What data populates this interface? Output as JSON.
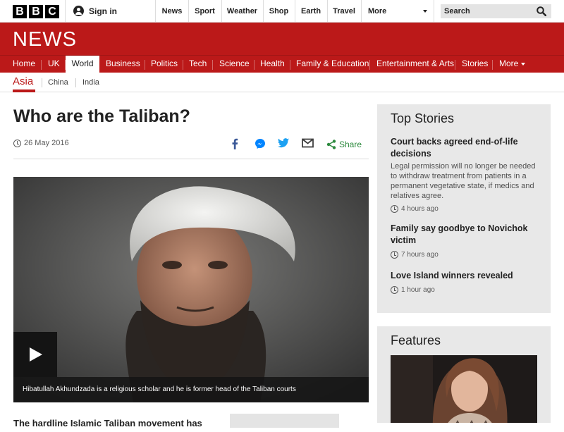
{
  "brand": {
    "logo_letters": [
      "B",
      "B",
      "C"
    ],
    "section": "NEWS"
  },
  "topbar": {
    "sign_in": "Sign in",
    "nav": [
      "News",
      "Sport",
      "Weather",
      "Shop",
      "Earth",
      "Travel"
    ],
    "more": "More",
    "search_placeholder": "Search"
  },
  "section_nav": {
    "items": [
      "Home",
      "UK",
      "World",
      "Business",
      "Politics",
      "Tech",
      "Science",
      "Health",
      "Family & Education",
      "Entertainment & Arts",
      "Stories"
    ],
    "more": "More",
    "active": "World"
  },
  "sub_nav": {
    "active": "Asia",
    "items": [
      "China",
      "India"
    ]
  },
  "article": {
    "headline": "Who are the Taliban?",
    "date": "26 May 2016",
    "share_label": "Share",
    "image_caption": "Hibatullah Akhundzada is a religious scholar and he is former head of the Taliban courts",
    "body_first_line": "The hardline Islamic Taliban movement has"
  },
  "top_stories": {
    "title": "Top Stories",
    "items": [
      {
        "title": "Court backs agreed end-of-life decisions",
        "summary": "Legal permission will no longer be needed to withdraw treatment from patients in a permanent vegetative state, if medics and relatives agree.",
        "time": "4 hours ago"
      },
      {
        "title": "Family say goodbye to Novichok victim",
        "summary": "",
        "time": "7 hours ago"
      },
      {
        "title": "Love Island winners revealed",
        "summary": "",
        "time": "1 hour ago"
      }
    ]
  },
  "features": {
    "title": "Features"
  },
  "colors": {
    "brand_red": "#bb1919",
    "panel_bg": "#e8e8e8",
    "share_green": "#2d8a3e",
    "facebook": "#3b5998",
    "twitter": "#1da1f2"
  }
}
